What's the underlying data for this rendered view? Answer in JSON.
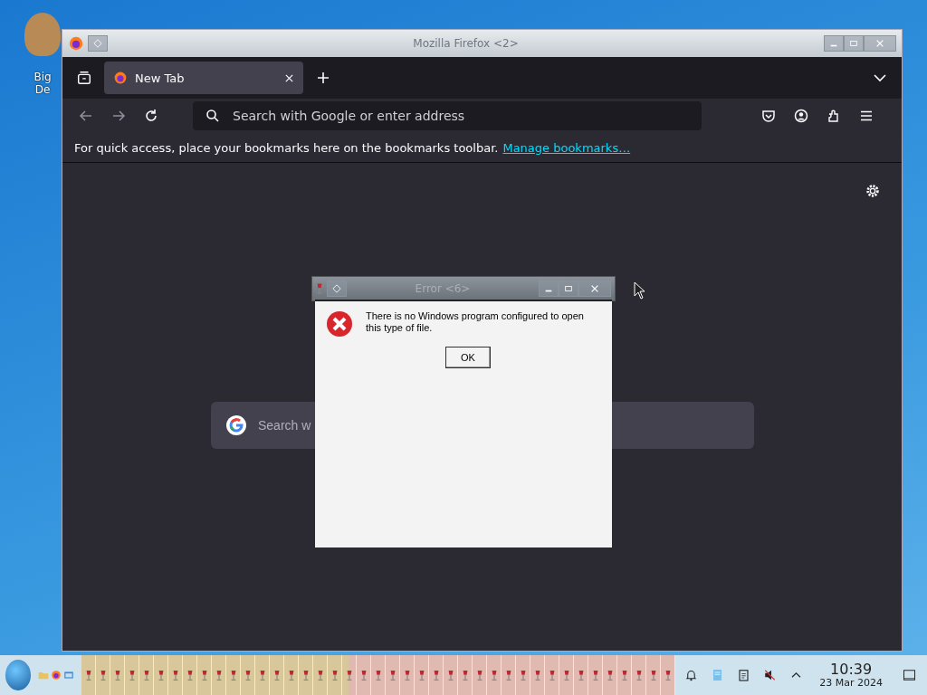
{
  "desktop_icon": {
    "label_lines": [
      "Big",
      "De"
    ]
  },
  "window": {
    "title": "Mozilla Firefox <2>"
  },
  "tabs": [
    {
      "label": "New Tab",
      "selected": true
    }
  ],
  "address_bar": {
    "placeholder": "Search with Google or enter address"
  },
  "bookmarks_bar": {
    "message": "For quick access, place your bookmarks here on the bookmarks toolbar.",
    "link": "Manage bookmarks…"
  },
  "page": {
    "search_placeholder": "Search w"
  },
  "dialog": {
    "title": "Error <6>",
    "message": "There is no Windows program configured to open this type of file.",
    "button": "OK"
  },
  "tray": {
    "muted": true,
    "time": "10:39",
    "date": "23 Mar 2024"
  }
}
